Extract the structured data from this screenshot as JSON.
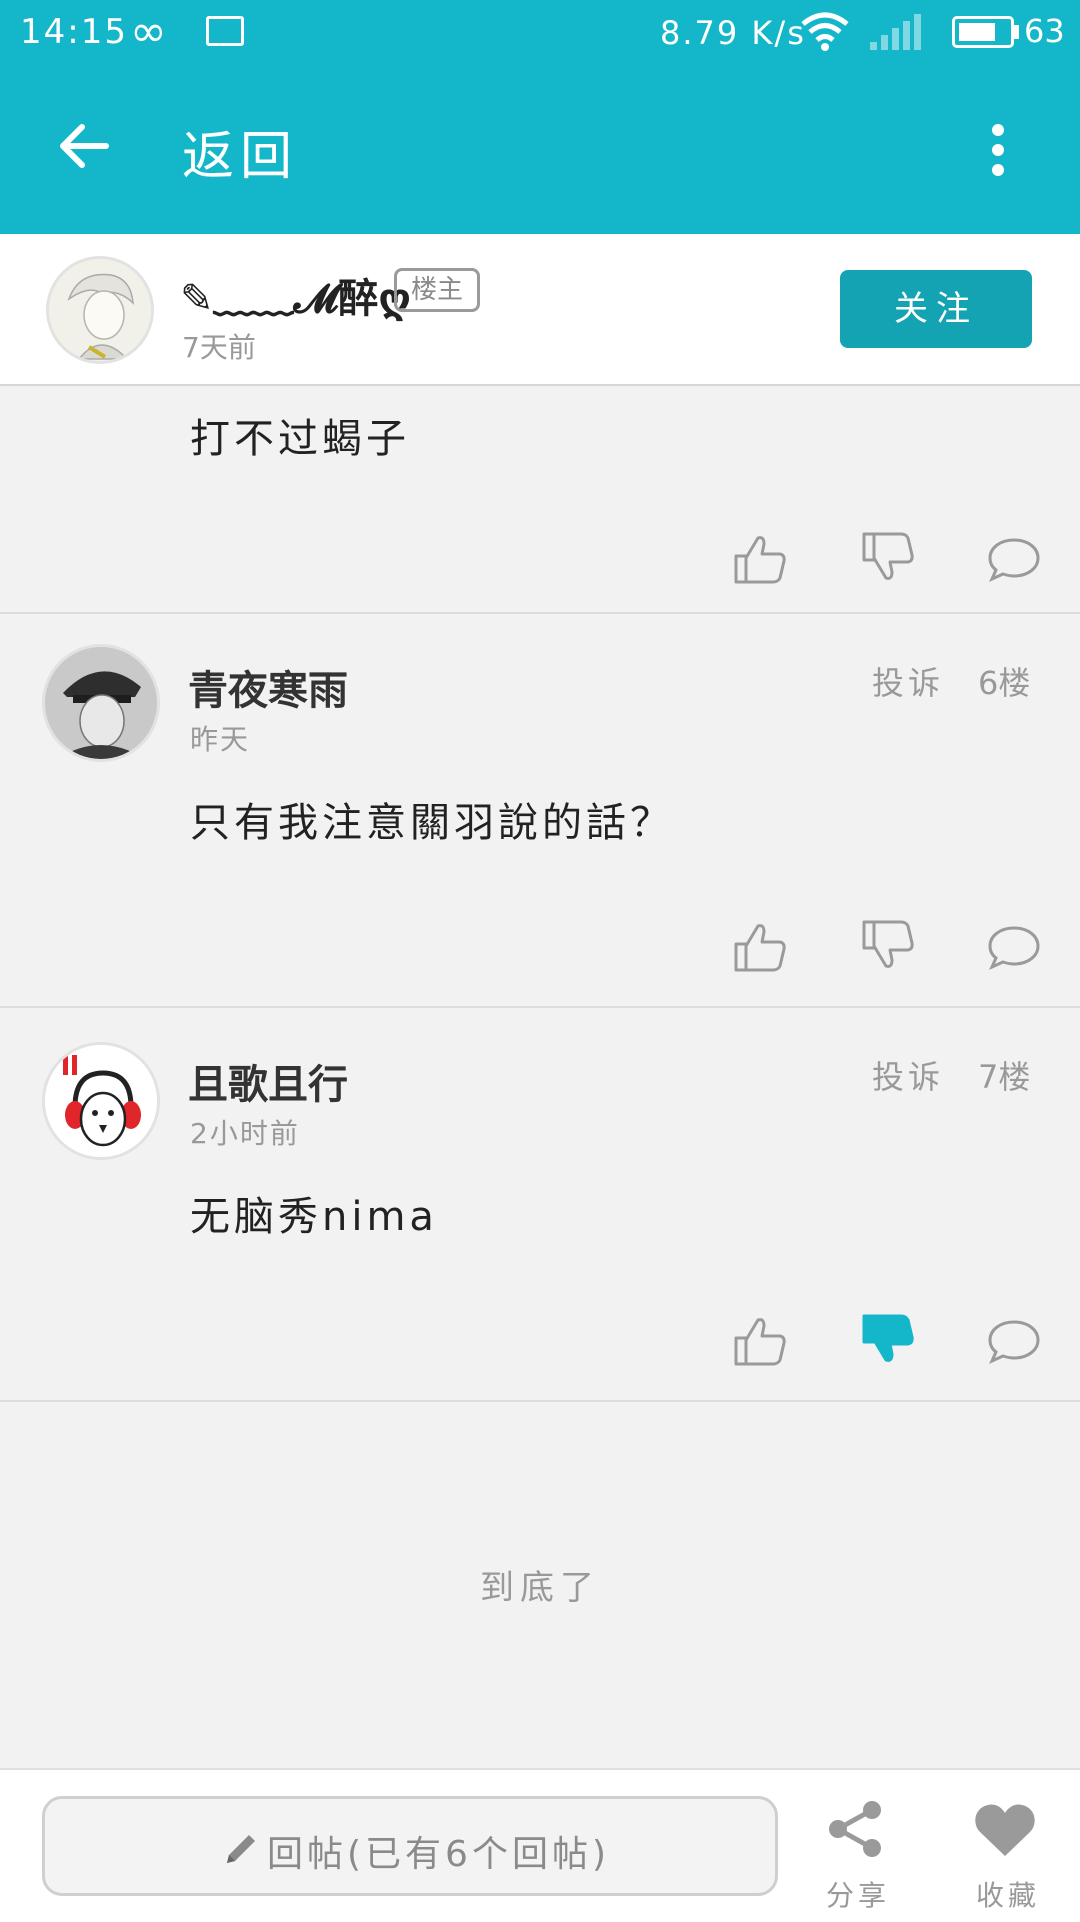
{
  "status_bar": {
    "time": "14:15",
    "network_speed": "8.79 K/s",
    "battery_level": "63"
  },
  "app_bar": {
    "title": "返回"
  },
  "op": {
    "name": "✎﹏﹏𝓜醉ღ",
    "badge": "楼主",
    "time": "7天前",
    "follow_label": "关注"
  },
  "posts": [
    {
      "body": "打不过蝎子"
    },
    {
      "author": "青夜寒雨",
      "time": "昨天",
      "report_label": "投诉",
      "floor": "6楼",
      "body": "只有我注意關羽說的話？"
    },
    {
      "author": "且歌且行",
      "time": "2小时前",
      "report_label": "投诉",
      "floor": "7楼",
      "body": "无脑秀nima",
      "disliked": true
    }
  ],
  "end_text": "到底了",
  "bottom_bar": {
    "reply_placeholder": "回帖(已有6个回帖)",
    "share_label": "分享",
    "favorite_label": "收藏"
  },
  "colors": {
    "primary": "#14b7c9",
    "follow_button": "#14a3b3",
    "active_icon": "#14b7c9",
    "icon_gray": "#9a9a9a"
  }
}
